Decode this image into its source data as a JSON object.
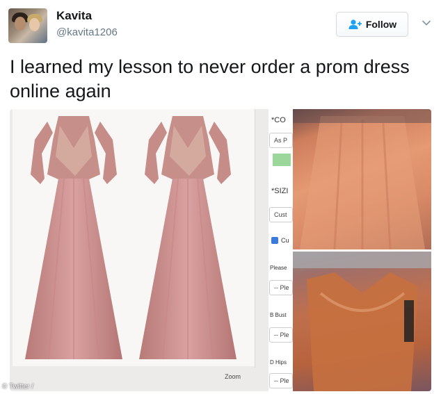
{
  "tweet": {
    "author_name": "Kavita",
    "author_handle": "@kavita1206",
    "follow_label": "Follow",
    "text": "I learned my lesson to never order a prom dress online again"
  },
  "media": {
    "form_labels": {
      "color_heading": "*CO",
      "as_pictured": "As P",
      "size_heading": "*SIZI",
      "custom": "Cust",
      "custom_check": "Cu",
      "please": "Please",
      "bust": "B Bust",
      "hips": "D Hips",
      "select_placeholder": "-- Ple",
      "zoom": "Zoom"
    }
  },
  "watermark": "© Twitter /",
  "colors": {
    "text_primary": "#14171a",
    "text_secondary": "#657786",
    "dress_pink": "#c98785",
    "dress_orange": "#d98a67"
  },
  "icons": {
    "follow": "add-user-icon",
    "menu": "chevron-down-icon"
  }
}
